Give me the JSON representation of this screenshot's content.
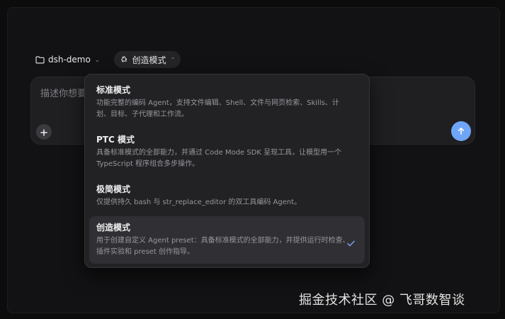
{
  "toolbar": {
    "project_label": "dsh-demo",
    "mode_label": "创造模式"
  },
  "composer": {
    "placeholder": "描述你想要"
  },
  "dropdown": {
    "items": [
      {
        "title": "标准模式",
        "description": "功能完整的编码 Agent，支持文件编辑、Shell、文件与网页检索、Skills、计划、目标、子代理和工作流。"
      },
      {
        "title": "PTC 模式",
        "description": "具备标准模式的全部能力，并通过 Code Mode SDK 呈现工具，让模型用一个 TypeScript 程序组合多步操作。"
      },
      {
        "title": "极简模式",
        "description": "仅提供持久 bash 与 str_replace_editor 的双工具编码 Agent。"
      },
      {
        "title": "创造模式",
        "description": "用于创建自定义 Agent preset：具备标准模式的全部能力，并提供运行时检查、插件实验和 preset 创作指导。",
        "selected": true
      }
    ]
  },
  "watermark": "掘金技术社区 @ 飞哥数智谈",
  "colors": {
    "background": "#0c0c0d",
    "panel": "#222225",
    "selected_row": "#303034",
    "accent": "#6fa5f7",
    "check": "#7f9df0"
  },
  "icons": {
    "project": "folder-icon",
    "mode": "recycle-icon",
    "caret": "chevron-down-icon",
    "add": "plus-icon",
    "send": "arrow-up-icon",
    "selected": "check-icon"
  }
}
